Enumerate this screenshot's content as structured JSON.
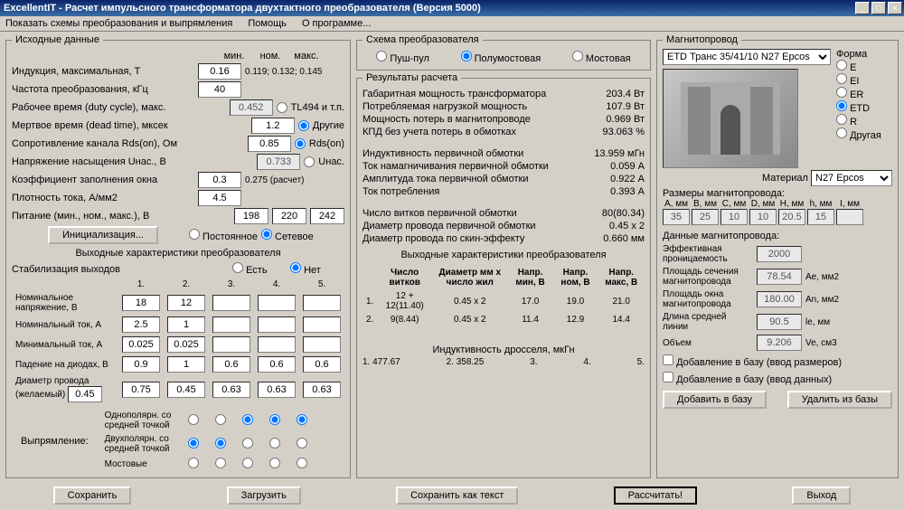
{
  "title": "ExcellentIT - Расчет импульсного трансформатора двухтактного преобразователя (Версия 5000)",
  "menu": {
    "schemes": "Показать схемы преобразования и выпрямления",
    "help": "Помощь",
    "about": "О программе..."
  },
  "input": {
    "legend": "Исходные данные",
    "colhdr": {
      "min": "мин.",
      "nom": "ном.",
      "max": "макс."
    },
    "induction_lbl": "Индукция, максимальная, Т",
    "induction": "0.16",
    "induction_range": "0.119; 0.132; 0.145",
    "freq_lbl": "Частота преобразования, кГц",
    "freq": "40",
    "duty_lbl": "Рабочее время (duty cycle), макс.",
    "duty": "0.452",
    "duty_opt": "TL494 и т.п.",
    "dead_lbl": "Мертвое время (dead time), мксек",
    "dead": "1.2",
    "dead_opt": "Другие",
    "rds_lbl": "Сопротивление канала Rds(on), Ом",
    "rds": "0.85",
    "rds_opt": "Rds(on)",
    "unas_lbl": "Напряжение насыщения Uнас., В",
    "unas": "0.733",
    "unas_opt": "Uнас.",
    "kfill_lbl": "Коэффициент заполнения окна",
    "kfill": "0.3",
    "kfill_calc": "0.275 (расчет)",
    "jdens_lbl": "Плотность тока, А/мм2",
    "jdens": "4.5",
    "psu_lbl": "Питание (мин., ном., макс.), В",
    "psu_min": "198",
    "psu_nom": "220",
    "psu_max": "242",
    "init_btn": "Инициализация...",
    "src_const": "Постоянное",
    "src_mains": "Сетевое"
  },
  "output": {
    "legend": "Выходные характеристики преобразователя",
    "stab_lbl": "Стабилизация выходов",
    "stab_yes": "Есть",
    "stab_no": "Нет",
    "cols": {
      "c1": "1.",
      "c2": "2.",
      "c3": "3.",
      "c4": "4.",
      "c5": "5."
    },
    "vnom_lbl": "Номинальное напряжение, В",
    "vnom": [
      "18",
      "12",
      "",
      "",
      ""
    ],
    "inom_lbl": "Номинальный ток, А",
    "inom": [
      "2.5",
      "1",
      "",
      "",
      ""
    ],
    "imin_lbl": "Минимальный ток, А",
    "imin": [
      "0.025",
      "0.025",
      "",
      "",
      ""
    ],
    "diode_lbl": "Падение на диодах, В",
    "diode": [
      "0.9",
      "1",
      "0.6",
      "0.6",
      "0.6"
    ],
    "wire_lbl": "Диаметр провода (желаемый)",
    "wire0": "0.45",
    "wire": [
      "0.75",
      "0.45",
      "0.63",
      "0.63",
      "0.63"
    ],
    "rect_lbl": "Выпрямление:",
    "rect1": "Однополярн. со средней точкой",
    "rect2": "Двухполярн. со средней точкой",
    "rect3": "Мостовые"
  },
  "scheme": {
    "legend": "Схема преобразователя",
    "push": "Пуш-пул",
    "half": "Полумостовая",
    "full": "Мостовая"
  },
  "results": {
    "legend": "Результаты расчета",
    "pgab_lbl": "Габаритная мощность трансформатора",
    "pgab": "203.4 Вт",
    "pload_lbl": "Потребляемая нагрузкой мощность",
    "pload": "107.9 Вт",
    "ploss_lbl": "Мощность потерь в магнитопроводе",
    "ploss": "0.969 Вт",
    "eff_lbl": "КПД без учета потерь в обмотках",
    "eff": "93.063 %",
    "l1_lbl": "Индуктивность первичной обмотки",
    "l1": "13.959 мГн",
    "imag_lbl": "Ток намагничивания первичной обмотки",
    "imag": "0.059 А",
    "iamp_lbl": "Амплитуда тока первичной обмотки",
    "iamp": "0.922 А",
    "icons_lbl": "Ток потребления",
    "icons": "0.393 А",
    "n1_lbl": "Число витков первичной обмотки",
    "n1": "80(80.34)",
    "d1_lbl": "Диаметр провода первичной обмотки",
    "d1": "0.45 x 2",
    "dskin_lbl": "Диаметр провода по скин-эффекту",
    "dskin": "0.660 мм",
    "out_legend": "Выходные характеристики преобразователя",
    "oh1": "Число витков",
    "oh2": "Диаметр мм x число жил",
    "oh3": "Напр. мин, В",
    "oh4": "Напр. ном, В",
    "oh5": "Напр. макс, В",
    "r1": {
      "n": "1.",
      "turns": "12 + 12(11.40)",
      "d": "0.45 x 2",
      "vmin": "17.0",
      "vnom": "19.0",
      "vmax": "21.0"
    },
    "r2": {
      "n": "2.",
      "turns": "9(8.44)",
      "d": "0.45 x 2",
      "vmin": "11.4",
      "vnom": "12.9",
      "vmax": "14.4"
    },
    "choke_lbl": "Индуктивность дросселя, мкГн",
    "choke": {
      "c1": "1. 477.67",
      "c2": "2. 358.25",
      "c3": "3.",
      "c4": "4.",
      "c5": "5."
    }
  },
  "core": {
    "legend": "Магнитопровод",
    "select": "ETD Транс 35/41/10 N27 Epcos",
    "shape_lbl": "Форма",
    "shapes": {
      "e": "E",
      "ei": "EI",
      "er": "ER",
      "etd": "ETD",
      "r": "R",
      "other": "Другая"
    },
    "mat_lbl": "Материал",
    "mat": "N27 Epcos",
    "sizes_lbl": "Размеры магнитопровода:",
    "sh": {
      "a": "A, мм",
      "b": "B, мм",
      "c": "C, мм",
      "d": "D, мм",
      "hh": "H, мм",
      "h": "h, мм",
      "i": "I, мм"
    },
    "sv": {
      "a": "35",
      "b": "25",
      "c": "10",
      "d": "10",
      "hh": "20.5",
      "h": "15",
      "i": ""
    },
    "props_lbl": "Данные магнитопровода:",
    "perm_lbl": "Эффективная проницаемость",
    "perm": "2000",
    "ae_lbl": "Площадь сечения магнитопровода",
    "ae": "78.54",
    "ae_u": "Ae, мм2",
    "an_lbl": "Площадь окна магнитопровода",
    "an": "180.00",
    "an_u": "An, мм2",
    "le_lbl": "Длина средней линии",
    "le": "90.5",
    "le_u": "le, мм",
    "ve_lbl": "Объем",
    "ve": "9.206",
    "ve_u": "Ve, см3",
    "chk1": "Добавление в базу (ввод размеров)",
    "chk2": "Добавление в базу (ввод данных)",
    "add_btn": "Добавить в базу",
    "del_btn": "Удалить из базы"
  },
  "buttons": {
    "save": "Сохранить",
    "load": "Загрузить",
    "save_txt": "Сохранить как текст",
    "calc": "Рассчитать!",
    "exit": "Выход"
  }
}
